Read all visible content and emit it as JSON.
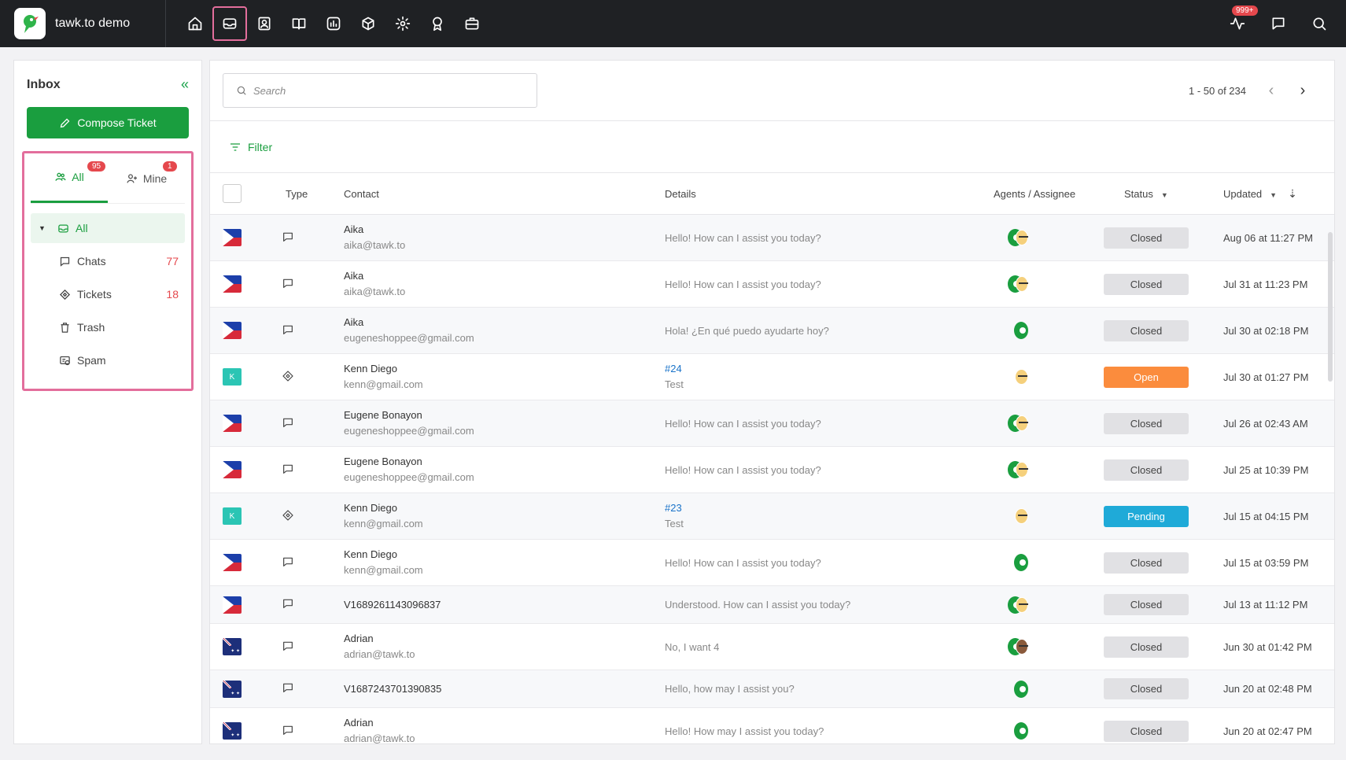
{
  "app": {
    "name": "tawk.to demo",
    "notif_count": "999+"
  },
  "nav": {
    "items": [
      "home-icon",
      "inbox-icon",
      "contacts-icon",
      "knowledge-base-icon",
      "reporting-icon",
      "addons-icon",
      "settings-icon",
      "badge-icon",
      "briefcase-icon"
    ]
  },
  "sidebar": {
    "title": "Inbox",
    "compose_label": "Compose Ticket",
    "tabs": [
      {
        "label": "All",
        "badge": "95"
      },
      {
        "label": "Mine",
        "badge": "1"
      }
    ],
    "folders": [
      {
        "label": "All",
        "count": ""
      },
      {
        "label": "Chats",
        "count": "77"
      },
      {
        "label": "Tickets",
        "count": "18"
      },
      {
        "label": "Trash",
        "count": ""
      },
      {
        "label": "Spam",
        "count": ""
      }
    ]
  },
  "search": {
    "placeholder": "Search"
  },
  "pager": {
    "text": "1 - 50 of 234"
  },
  "filter": {
    "label": "Filter"
  },
  "table": {
    "headers": {
      "type": "Type",
      "contact": "Contact",
      "details": "Details",
      "agents": "Agents / Assignee",
      "status": "Status",
      "updated": "Updated"
    },
    "rows": [
      {
        "flag": "ph",
        "type": "chat",
        "name": "Aika",
        "email": "aika@tawk.to",
        "detail": "Hello! How can I assist you today?",
        "agents": "green+face",
        "status": "Closed",
        "updated": "Aug 06 at 11:27 PM"
      },
      {
        "flag": "ph",
        "type": "chat",
        "name": "Aika",
        "email": "aika@tawk.to",
        "detail": "Hello! How can I assist you today?",
        "agents": "green+face",
        "status": "Closed",
        "updated": "Jul 31 at 11:23 PM"
      },
      {
        "flag": "ph",
        "type": "chat",
        "name": "Aika",
        "email": "eugeneshoppee@gmail.com",
        "detail": "Hola! ¿En qué puedo ayudarte hoy?",
        "agents": "green",
        "status": "Closed",
        "updated": "Jul 30 at 02:18 PM"
      },
      {
        "flag": "k",
        "type": "ticket",
        "name": "Kenn Diego",
        "email": "kenn@gmail.com",
        "ticket": "#24",
        "detail": "Test",
        "agents": "face",
        "status": "Open",
        "updated": "Jul 30 at 01:27 PM"
      },
      {
        "flag": "ph",
        "type": "chat",
        "name": "Eugene Bonayon",
        "email": "eugeneshoppee@gmail.com",
        "detail": "Hello! How can I assist you today?",
        "agents": "green+face",
        "status": "Closed",
        "updated": "Jul 26 at 02:43 AM"
      },
      {
        "flag": "ph",
        "type": "chat",
        "name": "Eugene Bonayon",
        "email": "eugeneshoppee@gmail.com",
        "detail": "Hello! How can I assist you today?",
        "agents": "green+face",
        "status": "Closed",
        "updated": "Jul 25 at 10:39 PM"
      },
      {
        "flag": "k",
        "type": "ticket",
        "name": "Kenn Diego",
        "email": "kenn@gmail.com",
        "ticket": "#23",
        "detail": "Test",
        "agents": "face",
        "status": "Pending",
        "updated": "Jul 15 at 04:15 PM"
      },
      {
        "flag": "ph",
        "type": "chat",
        "name": "Kenn Diego",
        "email": "kenn@gmail.com",
        "detail": "Hello! How can I assist you today?",
        "agents": "green",
        "status": "Closed",
        "updated": "Jul 15 at 03:59 PM"
      },
      {
        "flag": "ph",
        "type": "chat",
        "name": "V1689261143096837",
        "email": "",
        "detail": "Understood. How can I assist you today?",
        "agents": "green+face",
        "status": "Closed",
        "updated": "Jul 13 at 11:12 PM"
      },
      {
        "flag": "au",
        "type": "chat",
        "name": "Adrian",
        "email": "adrian@tawk.to",
        "detail": "No, I want 4",
        "agents": "green+dark",
        "status": "Closed",
        "updated": "Jun 30 at 01:42 PM"
      },
      {
        "flag": "au",
        "type": "chat",
        "name": "V1687243701390835",
        "email": "",
        "detail": "Hello, how may I assist you?",
        "agents": "green",
        "status": "Closed",
        "updated": "Jun 20 at 02:48 PM"
      },
      {
        "flag": "au",
        "type": "chat",
        "name": "Adrian",
        "email": "adrian@tawk.to",
        "detail": "Hello! How may I assist you today?",
        "agents": "green",
        "status": "Closed",
        "updated": "Jun 20 at 02:47 PM"
      }
    ]
  }
}
